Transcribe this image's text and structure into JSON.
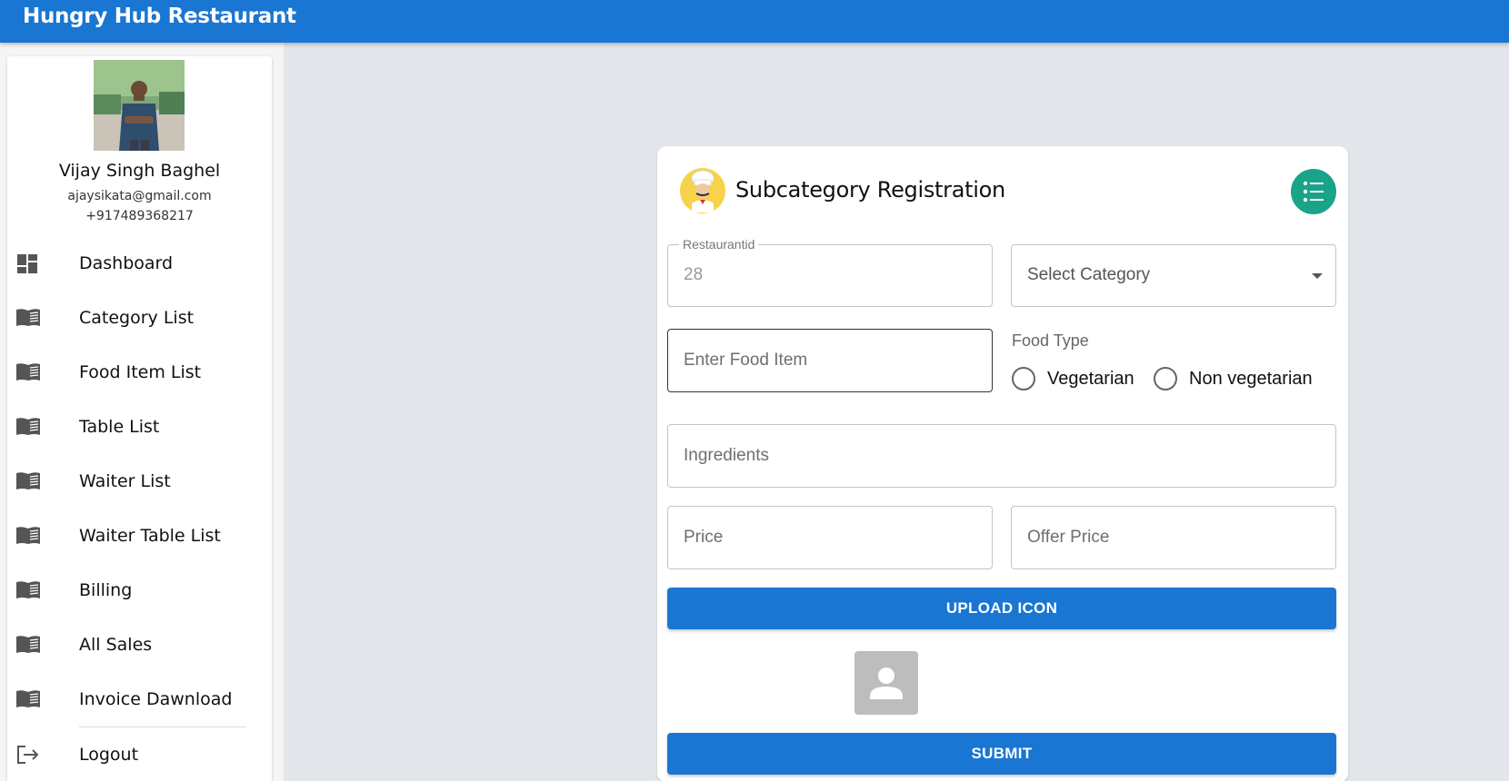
{
  "app": {
    "title": "Hungry Hub Restaurant"
  },
  "profile": {
    "name": "Vijay Singh Baghel",
    "email": "ajaysikata@gmail.com",
    "phone": "+917489368217"
  },
  "sidebar": {
    "items": [
      {
        "label": "Dashboard",
        "icon": "dashboard-icon"
      },
      {
        "label": "Category List",
        "icon": "book-icon"
      },
      {
        "label": "Food Item List",
        "icon": "book-icon"
      },
      {
        "label": "Table List",
        "icon": "book-icon"
      },
      {
        "label": "Waiter List",
        "icon": "book-icon"
      },
      {
        "label": "Waiter Table List",
        "icon": "book-icon"
      },
      {
        "label": "Billing",
        "icon": "book-icon"
      },
      {
        "label": "All Sales",
        "icon": "book-icon"
      },
      {
        "label": "Invoice Dawnload",
        "icon": "book-icon"
      }
    ],
    "logout": {
      "label": "Logout",
      "icon": "logout-icon"
    }
  },
  "form": {
    "title": "Subcategory Registration",
    "restaurant_id": {
      "label": "Restaurantid",
      "value": "28"
    },
    "category": {
      "label": "Select Category"
    },
    "food_item": {
      "placeholder": "Enter Food Item"
    },
    "food_type": {
      "label": "Food Type",
      "options": [
        "Vegetarian",
        "Non vegetarian"
      ]
    },
    "ingredients": {
      "placeholder": "Ingredients"
    },
    "price": {
      "placeholder": "Price"
    },
    "offer_price": {
      "placeholder": "Offer Price"
    },
    "upload_label": "UPLOAD ICON",
    "submit_label": "SUBMIT"
  },
  "colors": {
    "primary": "#1976d2",
    "accent": "#1aa389",
    "background": "#e3e7ec"
  }
}
